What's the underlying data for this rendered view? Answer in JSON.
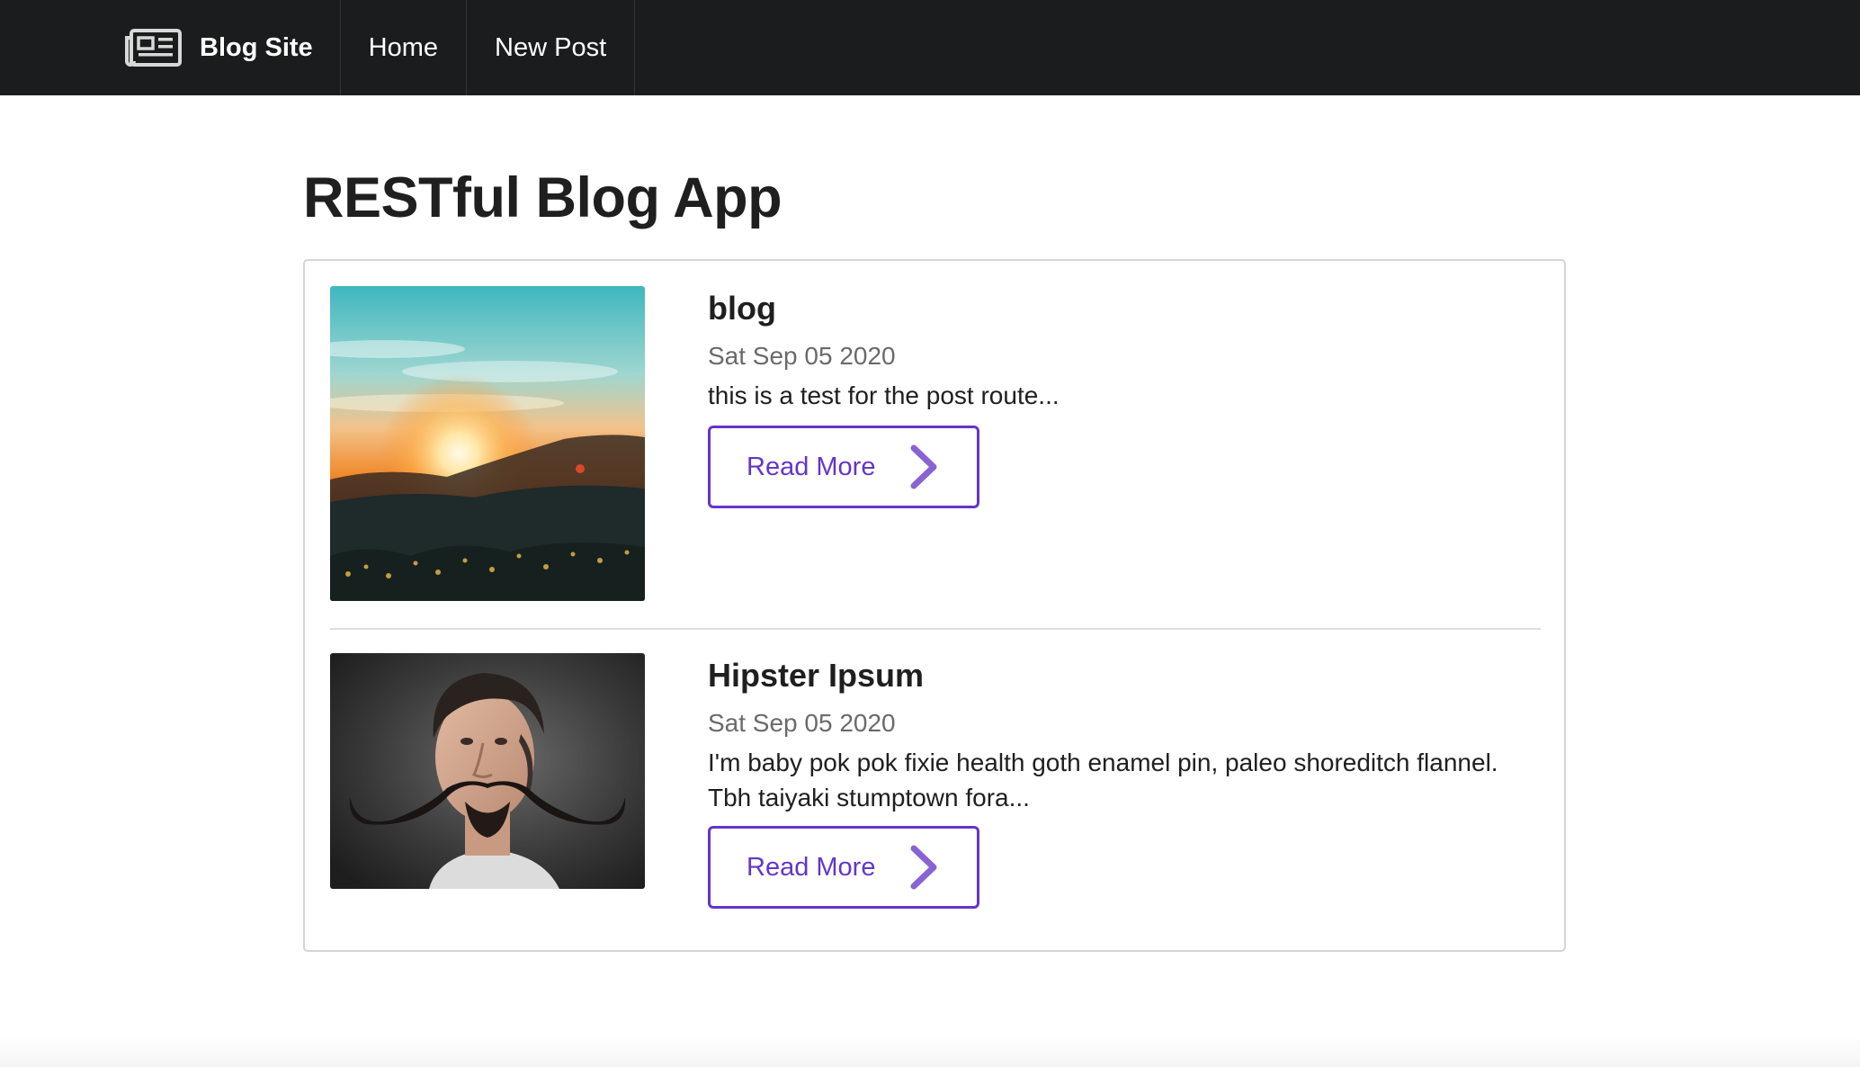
{
  "nav": {
    "brand_icon": "newspaper-icon",
    "brand_label": "Blog Site",
    "home_label": "Home",
    "new_post_label": "New Post"
  },
  "page": {
    "title": "RESTful Blog App"
  },
  "posts": [
    {
      "title": "blog",
      "date": "Sat Sep 05 2020",
      "excerpt": "this is a test for the post route...",
      "read_more_label": "Read More",
      "image": "sunset-mountains-photo"
    },
    {
      "title": "Hipster Ipsum",
      "date": "Sat Sep 05 2020",
      "excerpt": "I'm baby pok pok fixie health goth enamel pin, paleo shoreditch flannel. Tbh taiyaki stumptown fora...",
      "read_more_label": "Read More",
      "image": "mustache-man-photo"
    }
  ],
  "colors": {
    "nav_bg": "#1b1c1d",
    "accent": "#6435c9",
    "date_text": "#6a6a6a"
  }
}
